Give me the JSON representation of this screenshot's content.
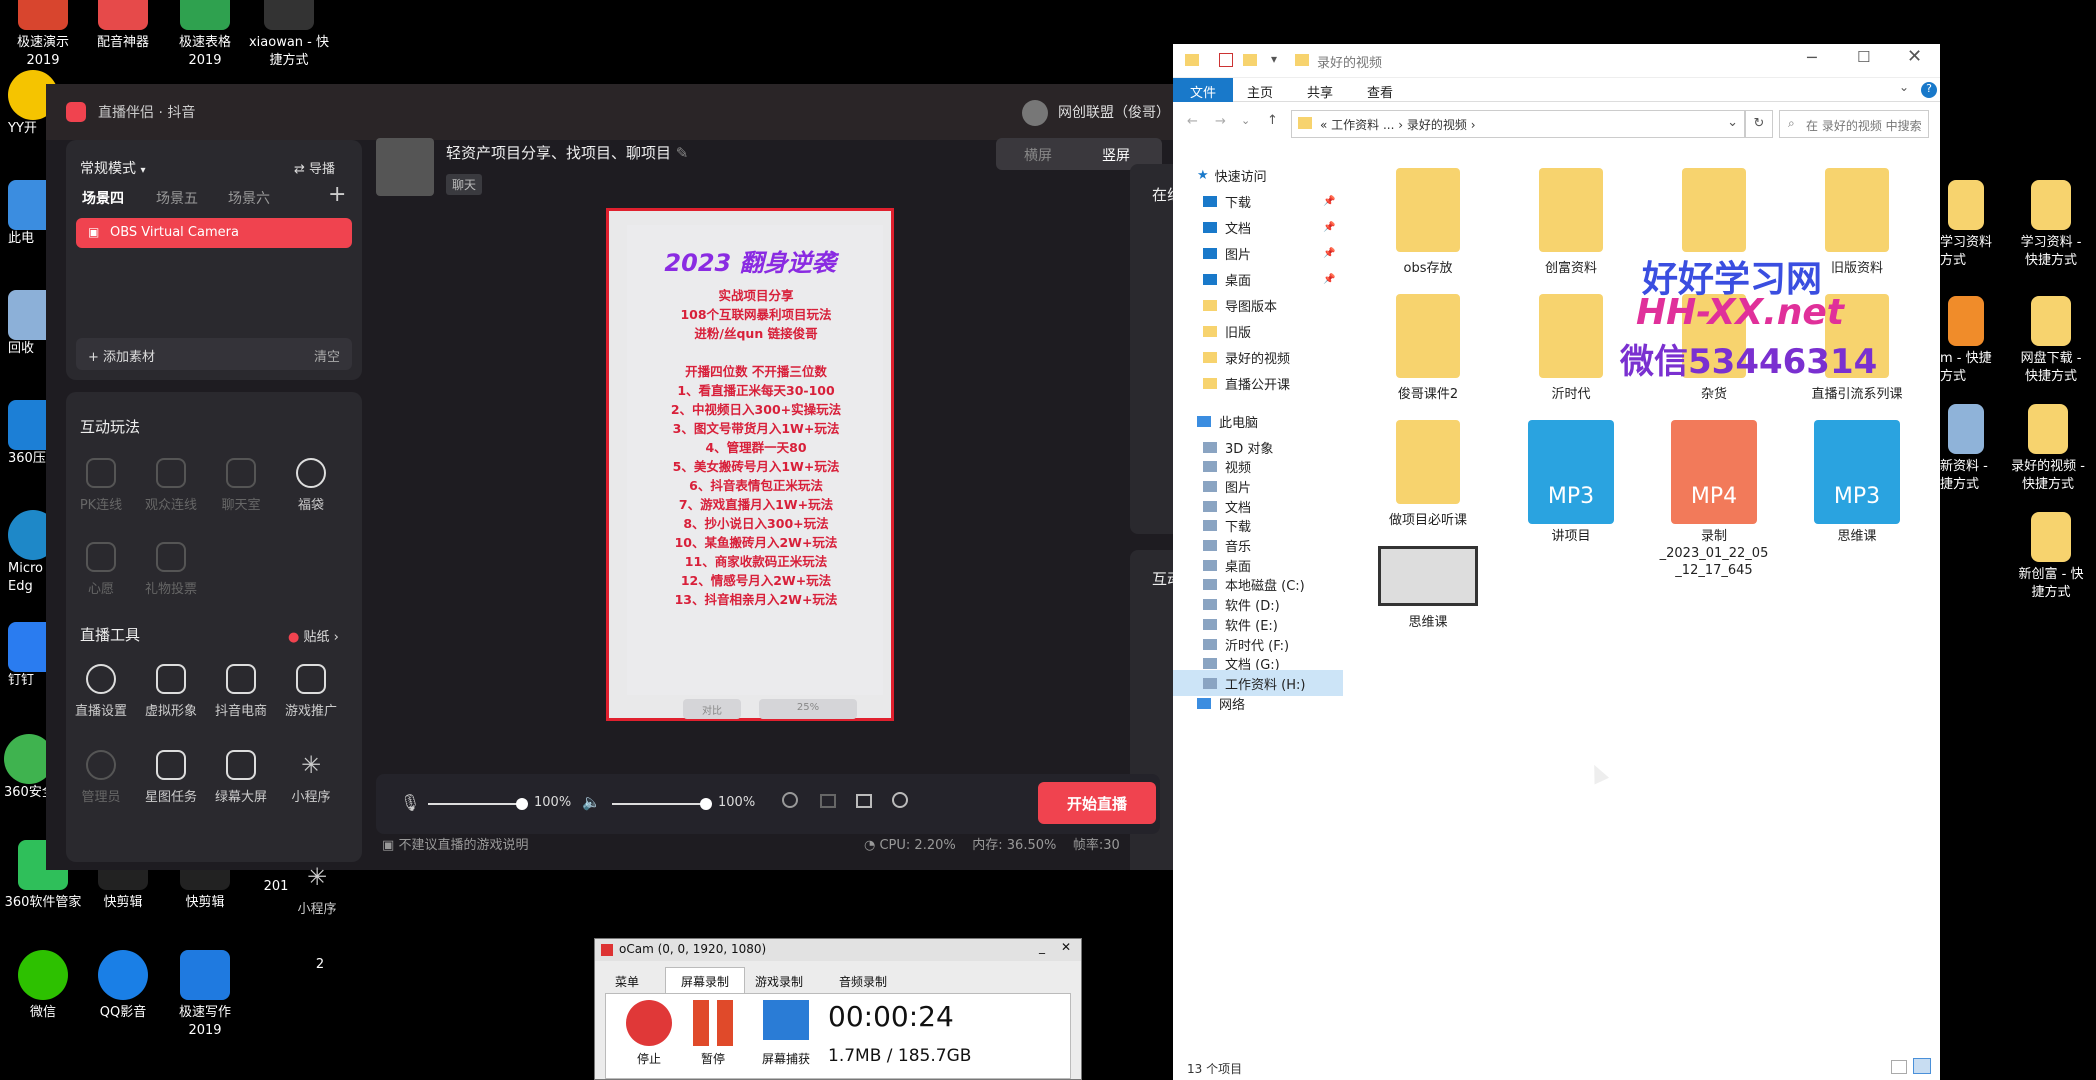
{
  "desktop": {
    "left_icons": [
      {
        "label": "极速演示\n2019",
        "color": "#d8452e"
      },
      {
        "label": "配音神器",
        "color": "#e64a4a"
      },
      {
        "label": "极速表格\n2019",
        "color": "#2fa14f"
      },
      {
        "label": "xiaowan - 快\n捷方式",
        "color": "#444"
      },
      {
        "label": "YY开",
        "color": "#f5c400"
      },
      {
        "label": "此电",
        "color": "#3b8de0"
      },
      {
        "label": "回收",
        "color": "#8cb0d8"
      },
      {
        "label": "360压",
        "color": "#1c7fd6"
      },
      {
        "label": "Micro\nEdg",
        "color": "#1e88c8"
      },
      {
        "label": "钉钉",
        "color": "#2a7cf0"
      },
      {
        "label": "360安全",
        "color": "#3fb34f"
      },
      {
        "label": "360软件管家",
        "color": "#2fbf5a"
      },
      {
        "label": "快剪辑",
        "color": "#222"
      },
      {
        "label": "快剪辑",
        "color": "#222"
      },
      {
        "label": "201",
        "color": "#222"
      },
      {
        "label": "微信",
        "color": "#2dc100"
      },
      {
        "label": "QQ影音",
        "color": "#1a7fe6"
      },
      {
        "label": "极速写作\n2019",
        "color": "#1f7ae0"
      },
      {
        "label": "2",
        "color": "#222"
      }
    ],
    "right_icons": [
      {
        "label": "学习资料\n方式"
      },
      {
        "label": "学习资料 -\n快捷方式"
      },
      {
        "label": "m - 快捷\n方式"
      },
      {
        "label": "网盘下载 -\n快捷方式"
      },
      {
        "label": "新资料 -\n捷方式"
      },
      {
        "label": "录好的视频 -\n快捷方式"
      },
      {
        "label": "新创富 - 快\n捷方式"
      }
    ]
  },
  "live": {
    "app_title": "直播伴侣 · 抖音",
    "user_name": "网创联盟（俊哥）",
    "mode": "常规模式",
    "guide": "导播",
    "scenes": [
      "场景四",
      "场景五",
      "场景六"
    ],
    "active_source": "OBS Virtual Camera",
    "add_material": "添加素材",
    "clear": "清空",
    "interactive_title": "互动玩法",
    "interactive": [
      {
        "label": "PK连线",
        "enabled": false
      },
      {
        "label": "观众连线",
        "enabled": false
      },
      {
        "label": "聊天室",
        "enabled": false
      },
      {
        "label": "福袋",
        "enabled": true
      },
      {
        "label": "心愿",
        "enabled": false
      },
      {
        "label": "礼物投票",
        "enabled": false
      }
    ],
    "tools_title": "直播工具",
    "sticker": "贴纸",
    "tools": [
      {
        "label": "直播设置",
        "enabled": true
      },
      {
        "label": "虚拟形象",
        "enabled": true
      },
      {
        "label": "抖音电商",
        "enabled": true
      },
      {
        "label": "游戏推广",
        "enabled": true
      },
      {
        "label": "管理员",
        "enabled": false
      },
      {
        "label": "星图任务",
        "enabled": true
      },
      {
        "label": "绿幕大屏",
        "enabled": true
      },
      {
        "label": "小程序",
        "enabled": true
      }
    ],
    "extra_tool": "小程序",
    "stream_title": "轻资产项目分享、找项目、聊项目",
    "category": "聊天",
    "orientation": [
      "横屏",
      "竖屏"
    ],
    "right_tabs": [
      "在线",
      "互动"
    ],
    "mic_volume": "100%",
    "speaker_volume": "100%",
    "start_button": "开始直播",
    "warning": "不建议直播的游戏说明",
    "cpu": "CPU: 2.20%",
    "memory": "内存: 36.50%",
    "fps": "帧率:30",
    "preview_ctrl_left": "对比",
    "preview_zoom": "25%",
    "poster": {
      "title": "2023  翻身逆袭",
      "lines": [
        "实战项目分享",
        "108个互联网暴利项目玩法",
        "进粉/丝qun  链接俊哥",
        "",
        "开播四位数  不开播三位数",
        "1、看直播正米每天30-100",
        "2、中视频日入300+实操玩法",
        "3、图文号带货月入1W+玩法",
        "4、管理群一天80",
        "5、美女搬砖号月入1W+玩法",
        "6、抖音表情包正米玩法",
        "7、游戏直播月入1W+玩法",
        "8、抄小说日入300+玩法",
        "10、某鱼搬砖月入2W+玩法",
        "11、商家收款码正米玩法",
        "12、情感号月入2W+玩法",
        "13、抖音相亲月入2W+玩法"
      ]
    }
  },
  "explorer": {
    "window_title": "录好的视频",
    "ribbon_tabs": [
      "文件",
      "主页",
      "共享",
      "查看"
    ],
    "path": [
      "工作资料 ...",
      "录好的视频"
    ],
    "search_placeholder": "在 录好的视频 中搜索",
    "quick_access": "快速访问",
    "nav": [
      {
        "label": "下载",
        "pinned": true
      },
      {
        "label": "文档",
        "pinned": true
      },
      {
        "label": "图片",
        "pinned": true
      },
      {
        "label": "桌面",
        "pinned": true
      },
      {
        "label": "导图版本",
        "pinned": false
      },
      {
        "label": "旧版",
        "pinned": false
      },
      {
        "label": "录好的视频",
        "pinned": false
      },
      {
        "label": "直播公开课",
        "pinned": false
      }
    ],
    "this_pc": "此电脑",
    "pc_nav": [
      "3D 对象",
      "视频",
      "图片",
      "文档",
      "下载",
      "音乐",
      "桌面",
      "本地磁盘 (C:)",
      "软件 (D:)",
      "软件 (E:)",
      "沂时代 (F:)",
      "文档 (G:)",
      "工作资料 (H:)"
    ],
    "network": "网络",
    "files": [
      {
        "name": "obs存放",
        "type": "folder"
      },
      {
        "name": "创富资料",
        "type": "folder"
      },
      {
        "name": "",
        "type": "folder"
      },
      {
        "name": "旧版资料",
        "type": "folder"
      },
      {
        "name": "俊哥课件2",
        "type": "folder"
      },
      {
        "name": "沂时代",
        "type": "folder"
      },
      {
        "name": "杂货",
        "type": "folder"
      },
      {
        "name": "直播引流系列课",
        "type": "folder"
      },
      {
        "name": "做项目必听课",
        "type": "folder"
      },
      {
        "name": "讲项目",
        "type": "MP3"
      },
      {
        "name": "录制\n_2023_01_22_05\n_12_17_645",
        "type": "MP4"
      },
      {
        "name": "思维课",
        "type": "MP3"
      },
      {
        "name": "思维课",
        "type": "video"
      }
    ],
    "status": "13 个项目"
  },
  "watermark": {
    "line1": "好好学习网",
    "line2": "HH-XX.net",
    "line3": "微信53446314"
  },
  "ocam": {
    "title": "oCam (0, 0, 1920, 1080)",
    "tabs": [
      "菜单",
      "屏幕录制",
      "游戏录制",
      "音频录制"
    ],
    "buttons": [
      "停止",
      "暂停",
      "屏幕捕获"
    ],
    "time": "00:00:24",
    "size": "1.7MB / 185.7GB"
  },
  "colors": {
    "accent_red": "#f0434f",
    "explorer_blue": "#1979ca"
  }
}
